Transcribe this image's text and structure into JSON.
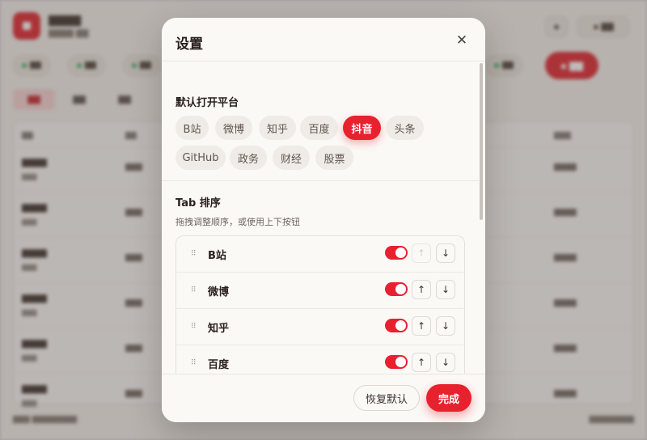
{
  "modal": {
    "title": "设置",
    "close_icon": "close-icon",
    "platform_section": {
      "title": "默认打开平台",
      "options": [
        "B站",
        "微博",
        "知乎",
        "百度",
        "抖音",
        "头条",
        "GitHub",
        "政务",
        "财经",
        "股票"
      ],
      "selected": "抖音"
    },
    "tab_order_section": {
      "title": "Tab 排序",
      "hint": "拖拽调整顺序，或使用上下按钮",
      "rows": [
        {
          "name": "B站",
          "enabled": true
        },
        {
          "name": "微博",
          "enabled": true
        },
        {
          "name": "知乎",
          "enabled": true
        },
        {
          "name": "百度",
          "enabled": true
        }
      ],
      "up_icon": "↑",
      "down_icon": "↓",
      "drag_icon": "⠿"
    },
    "footer": {
      "reset_label": "恢复默认",
      "done_label": "完成"
    }
  },
  "colors": {
    "accent": "#e8212e",
    "modal_bg": "#fbf9f6",
    "chip_bg": "#efebe6"
  }
}
